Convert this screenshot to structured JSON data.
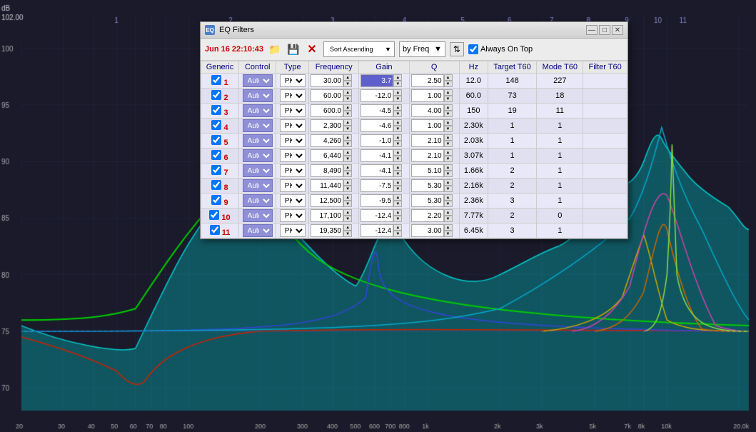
{
  "window": {
    "title": "EQ Filters",
    "timestamp": "Jun 16 22:10:43",
    "buttons": {
      "minimize": "—",
      "maximize": "□",
      "close": "✕"
    }
  },
  "toolbar": {
    "sort_label": "Sort Ascending",
    "freq_label": "by Freq",
    "always_on_top_label": "Always On Top",
    "always_on_top_checked": true
  },
  "table": {
    "headers": [
      "Generic",
      "Control",
      "Type",
      "Frequency",
      "Gain",
      "Q",
      "Hz",
      "Target T60",
      "Mode T60",
      "Filter T60"
    ],
    "rows": [
      {
        "id": 1,
        "checked": true,
        "control": "Auto",
        "type": "PK",
        "freq": "30.00",
        "gain": "3.7",
        "q": "2.50",
        "hz": "12.0",
        "target_t60": "148",
        "mode_t60": "227",
        "filter_t60": ""
      },
      {
        "id": 2,
        "checked": true,
        "control": "Auto",
        "type": "PK",
        "freq": "60.00",
        "gain": "-12.0",
        "q": "1.00",
        "hz": "60.0",
        "target_t60": "73",
        "mode_t60": "18",
        "filter_t60": ""
      },
      {
        "id": 3,
        "checked": true,
        "control": "Auto",
        "type": "PK",
        "freq": "600.0",
        "gain": "-4.5",
        "q": "4.00",
        "hz": "150",
        "target_t60": "19",
        "mode_t60": "11",
        "filter_t60": ""
      },
      {
        "id": 4,
        "checked": true,
        "control": "Auto",
        "type": "PK",
        "freq": "2,300",
        "gain": "-4.6",
        "q": "1.00",
        "hz": "2.30k",
        "target_t60": "1",
        "mode_t60": "1",
        "filter_t60": ""
      },
      {
        "id": 5,
        "checked": true,
        "control": "Auto",
        "type": "PK",
        "freq": "4,260",
        "gain": "-1.0",
        "q": "2.10",
        "hz": "2.03k",
        "target_t60": "1",
        "mode_t60": "1",
        "filter_t60": ""
      },
      {
        "id": 6,
        "checked": true,
        "control": "Auto",
        "type": "PK",
        "freq": "6,440",
        "gain": "-4.1",
        "q": "2.10",
        "hz": "3.07k",
        "target_t60": "1",
        "mode_t60": "1",
        "filter_t60": ""
      },
      {
        "id": 7,
        "checked": true,
        "control": "Auto",
        "type": "PK",
        "freq": "8,490",
        "gain": "-4.1",
        "q": "5.10",
        "hz": "1.66k",
        "target_t60": "2",
        "mode_t60": "1",
        "filter_t60": ""
      },
      {
        "id": 8,
        "checked": true,
        "control": "Auto",
        "type": "PK",
        "freq": "11,440",
        "gain": "-7.5",
        "q": "5.30",
        "hz": "2.16k",
        "target_t60": "2",
        "mode_t60": "1",
        "filter_t60": ""
      },
      {
        "id": 9,
        "checked": true,
        "control": "Auto",
        "type": "PK",
        "freq": "12,500",
        "gain": "-9.5",
        "q": "5.30",
        "hz": "2.36k",
        "target_t60": "3",
        "mode_t60": "1",
        "filter_t60": ""
      },
      {
        "id": 10,
        "checked": true,
        "control": "Auto",
        "type": "PK",
        "freq": "17,100",
        "gain": "-12.4",
        "q": "2.20",
        "hz": "7.77k",
        "target_t60": "2",
        "mode_t60": "0",
        "filter_t60": ""
      },
      {
        "id": 11,
        "checked": true,
        "control": "Auto",
        "type": "PK",
        "freq": "19,350",
        "gain": "-12.4",
        "q": "3.00",
        "hz": "6.45k",
        "target_t60": "3",
        "mode_t60": "1",
        "filter_t60": ""
      }
    ]
  },
  "chart": {
    "x_labels": [
      "20",
      "30",
      "40",
      "50",
      "60",
      "70",
      "80",
      "100",
      "200",
      "300",
      "400",
      "500",
      "600",
      "700",
      "800",
      "1k",
      "2k",
      "3k",
      "5k",
      "7k",
      "8k",
      "10k",
      "20.0k"
    ],
    "y_labels": [
      "102.00",
      "100",
      "95",
      "90",
      "85",
      "80",
      "75",
      "70"
    ],
    "freq_labels_top": [
      "1",
      "2",
      "3",
      "4",
      "5",
      "6",
      "7",
      "8",
      "9",
      "10",
      "11"
    ],
    "db_label": "dB"
  }
}
